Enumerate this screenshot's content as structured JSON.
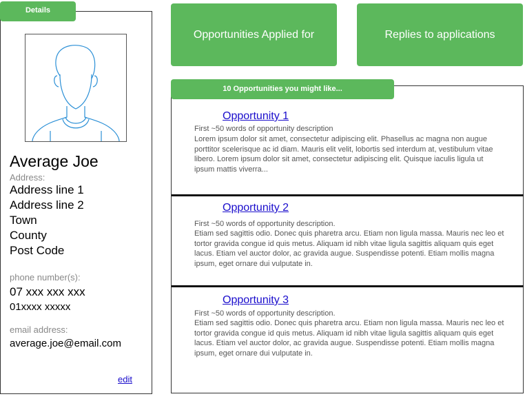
{
  "details": {
    "tab_label": "Details",
    "name": "Average Joe",
    "address_label": "Address:",
    "address_lines": [
      "Address line 1",
      "Address line 2",
      "Town",
      "County",
      "Post Code"
    ],
    "phone_label": "phone number(s):",
    "phones": [
      "07 xxx xxx xxx",
      "01xxxx xxxxx"
    ],
    "email_label": "email address:",
    "email": "average.joe@email.com",
    "edit_label": "edit"
  },
  "actions": {
    "applied_label": "Opportunities Applied for",
    "replies_label": "Replies to applications"
  },
  "opportunities": {
    "tab_label": "10 Opportunities you might like...",
    "items": [
      {
        "title": "Opportunity 1",
        "subtitle": "First ~50 words of opportunity description",
        "body": "Lorem ipsum dolor sit amet, consectetur adipiscing elit. Phasellus ac magna non augue porttitor scelerisque ac id diam. Mauris elit velit, lobortis sed interdum at, vestibulum vitae libero. Lorem ipsum dolor sit amet, consectetur adipiscing elit. Quisque iaculis ligula ut ipsum mattis viverra..."
      },
      {
        "title": "Opportunity 2",
        "subtitle": "First ~50 words of opportunity description.",
        "body": "Etiam sed sagittis odio. Donec quis pharetra arcu. Etiam non ligula massa. Mauris nec leo et tortor gravida congue id quis metus. Aliquam id nibh vitae ligula sagittis aliquam quis eget lacus. Etiam vel auctor dolor, ac gravida augue. Suspendisse potenti. Etiam mollis magna ipsum, eget ornare dui vulputate in."
      },
      {
        "title": "Opportunity 3",
        "subtitle": "First ~50 words of opportunity description.",
        "body": "Etiam sed sagittis odio. Donec quis pharetra arcu. Etiam non ligula massa. Mauris nec leo et tortor gravida congue id quis metus. Aliquam id nibh vitae ligula sagittis aliquam quis eget lacus. Etiam vel auctor dolor, ac gravida augue. Suspendisse potenti. Etiam mollis magna ipsum, eget ornare dui vulputate in."
      }
    ]
  },
  "colors": {
    "accent": "#5cb85c",
    "link": "#1a0dcc",
    "avatar_stroke": "#2a8fd6"
  },
  "icons": {
    "avatar": "user-avatar-icon"
  }
}
